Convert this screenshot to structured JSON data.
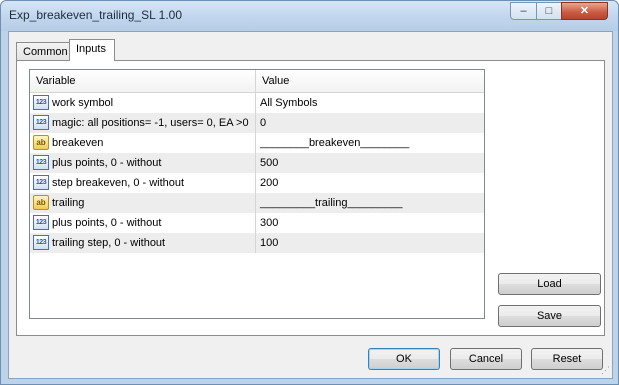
{
  "window": {
    "title": "Exp_breakeven_trailing_SL 1.00",
    "minimize_glyph": "–",
    "maximize_glyph": "□",
    "close_glyph": "✕"
  },
  "tabs": [
    {
      "label": "Common",
      "active": false
    },
    {
      "label": "Inputs",
      "active": true
    }
  ],
  "grid": {
    "columns": [
      "Variable",
      "Value"
    ],
    "rows": [
      {
        "icon": "number-icon",
        "icon_text": "123",
        "name": "work symbol",
        "value": "All Symbols"
      },
      {
        "icon": "number-icon",
        "icon_text": "123",
        "name": "magic: all positions= -1, users= 0, EA >0",
        "value": "0"
      },
      {
        "icon": "string-icon",
        "icon_text": "ab",
        "name": "breakeven",
        "value": "________breakeven________"
      },
      {
        "icon": "number-icon",
        "icon_text": "123",
        "name": "plus points, 0 - without",
        "value": "500"
      },
      {
        "icon": "number-icon",
        "icon_text": "123",
        "name": "step breakeven, 0 - without",
        "value": "200"
      },
      {
        "icon": "string-icon",
        "icon_text": "ab",
        "name": "trailing",
        "value": "_________trailing_________"
      },
      {
        "icon": "number-icon",
        "icon_text": "123",
        "name": "plus points, 0 - without",
        "value": "300"
      },
      {
        "icon": "number-icon",
        "icon_text": "123",
        "name": "trailing step, 0 - without",
        "value": "100"
      }
    ]
  },
  "side_buttons": {
    "load": "Load",
    "save": "Save"
  },
  "footer_buttons": {
    "ok": "OK",
    "cancel": "Cancel",
    "reset": "Reset"
  }
}
